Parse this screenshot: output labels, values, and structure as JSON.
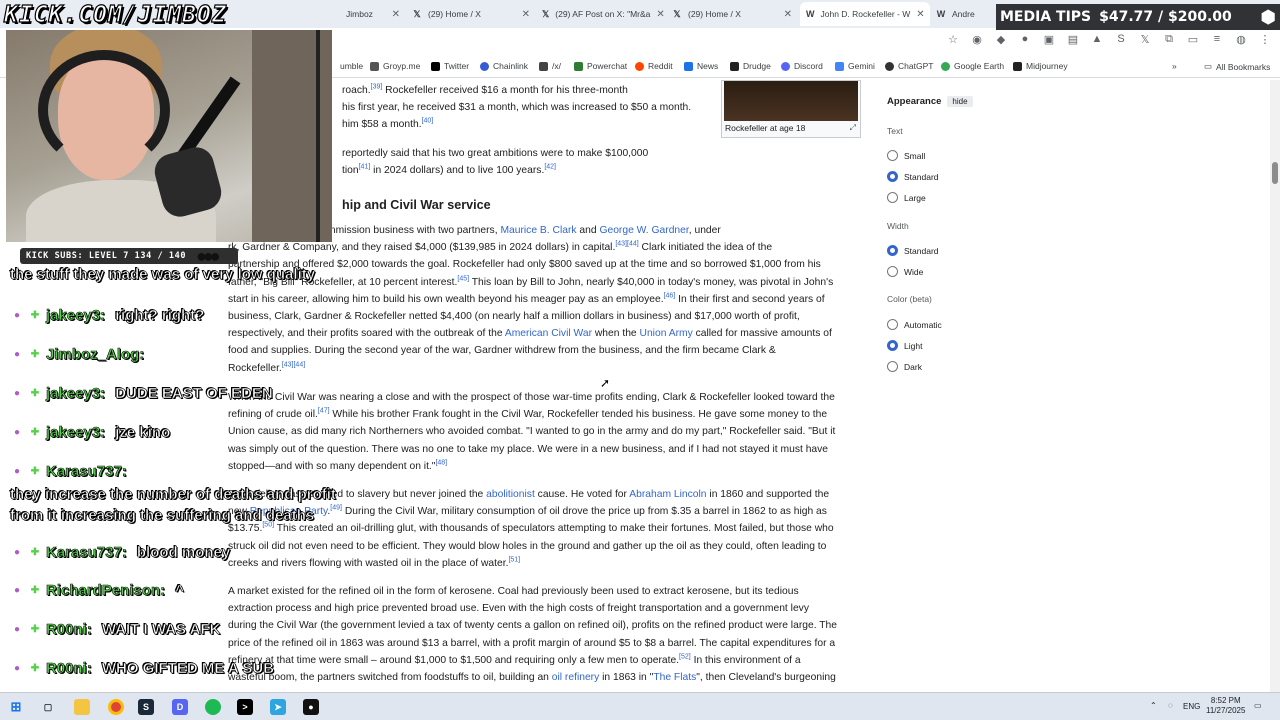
{
  "browser": {
    "tabs": [
      {
        "label": "Jimboz",
        "icon": "doc-icon",
        "active": false
      },
      {
        "label": "(29) Home / X",
        "icon": "x-icon",
        "active": false
      },
      {
        "label": "(29) AF Post on X: \"Mr&a",
        "icon": "x-icon",
        "active": false
      },
      {
        "label": "(29) Home / X",
        "icon": "x-icon",
        "active": false
      },
      {
        "label": "John D. Rockefeller - W",
        "icon": "wikipedia-icon",
        "active": true
      },
      {
        "label": "Andre",
        "icon": "wikipedia-icon",
        "active": false
      }
    ],
    "bookmarks": [
      "umble",
      "Groyp.me",
      "Twitter",
      "Chainlink",
      "/x/",
      "Powerchat",
      "Reddit",
      "News",
      "Drudge",
      "Discord",
      "Gemini",
      "ChatGPT",
      "Google Earth",
      "Midjourney"
    ],
    "all_bookmarks": "All Bookmarks"
  },
  "overlay": {
    "brand": "KICK.COM/JIMBOZ",
    "media_tips": {
      "label": "MEDIA TIPS",
      "progress": "$47.77 / $200.00"
    },
    "kick_subs": "KICK SUBS: LEVEL 7 134 / 140",
    "chat": [
      {
        "type": "line",
        "text": "the stuff they made was of very low quality"
      },
      {
        "type": "msg",
        "user": "jakeey3:",
        "text": "right? right?"
      },
      {
        "type": "msg",
        "user": "Jimboz_Alog:",
        "text": ""
      },
      {
        "type": "msg",
        "user": "jakeey3:",
        "text": "DUDE EAST OF EDEN"
      },
      {
        "type": "msg",
        "user": "jakeey3:",
        "text": "jze kino"
      },
      {
        "type": "msg",
        "user": "Karasu737:",
        "text": ""
      },
      {
        "type": "line",
        "text": "they increase the number of deaths and profit"
      },
      {
        "type": "line",
        "text": "from it increasing the suffering and deaths"
      },
      {
        "type": "msg",
        "user": "Karasu737:",
        "text": "blood money"
      },
      {
        "type": "msg",
        "user": "RichardPenison:",
        "text": "^"
      },
      {
        "type": "msg",
        "user": "R00ni:",
        "text": "WAIT I WAS AFK"
      },
      {
        "type": "msg",
        "user": "R00ni:",
        "text": "WHO GIFTED ME A SUB"
      }
    ]
  },
  "article": {
    "p0_l1": "roach.",
    "p0_l1_ref": "[39]",
    "p0_l1_b": " Rockefeller received $16 a month for his three-month",
    "p0_l2": "his first year, he received $31 a month, which was increased to $50 a month.",
    "p0_l3": "him $58 a month.",
    "p0_l3_ref": "[40]",
    "p1_l1": "reportedly said that his two great ambitions were to make $100,000",
    "p1_l2a": "tion",
    "p1_l2_ref1": "[41]",
    "p1_l2b": " in 2024 dollars) and to live 100 years.",
    "p1_l2_ref2": "[42]",
    "heading": "hip and Civil War service",
    "p2": [
      "nt into the produce commission business with two partners, |Maurice B. Clark| and |George W. Gardner|, under",
      "rk, Gardner & Company, and they raised $4,000 ($139,985 in 2024 dollars) in capital.^[43][44]^ Clark initiated the idea of the",
      "partnership and offered $2,000 towards the goal. Rockefeller had only $800 saved up at the time and so borrowed $1,000 from his",
      "father, \"Big Bill\" Rockefeller, at 10 percent interest.^[45]^ This loan by Bill to John, nearly $40,000 in today's money, was pivotal in John's",
      "start in his career, allowing him to build his own wealth beyond his meager pay as an employee.^[46]^ In their first and second years of",
      "business, Clark, Gardner & Rockefeller netted $4,400 (on nearly half a million dollars in business) and $17,000 worth of profit,",
      "respectively, and their profits soared with the outbreak of the |American Civil War| when the |Union Army| called for massive amounts of",
      "food and supplies. During the second year of the war, Gardner withdrew from the business, and the firm became Clark &",
      "Rockefeller.^[43][44]^"
    ],
    "p3": [
      "When the Civil War was nearing a close and with the prospect of those war-time profits ending, Clark & Rockefeller looked toward the",
      "refining of crude oil.^[47]^ While his brother Frank fought in the Civil War, Rockefeller tended his business. He gave some money to the",
      "Union cause, as did many rich Northerners who avoided combat. \"I wanted to go in the army and do my part,\" Rockefeller said. \"But it",
      "was simply out of the question. There was no one to take my place. We were in a new business, and if I had not stayed it must have",
      "stopped—and with so many dependent on it.\"^[48]^"
    ],
    "p4": [
      "Rockefeller was opposed to slavery but never joined the |abolitionist| cause. He voted for |Abraham Lincoln| in 1860 and supported the",
      "new |Republican Party|.^[49]^ During the Civil War, military consumption of oil drove the price up from $.35 a barrel in 1862 to as high as",
      "$13.75.^[50]^ This created an oil-drilling glut, with thousands of speculators attempting to make their fortunes. Most failed, but those who",
      "struck oil did not even need to be efficient. They would blow holes in the ground and gather up the oil as they could, often leading to",
      "creeks and rivers flowing with wasted oil in the place of water.^[51]^"
    ],
    "p5": [
      "A market existed for the refined oil in the form of kerosene. Coal had previously been used to extract kerosene, but its tedious",
      "extraction process and high price prevented broad use. Even with the high costs of freight transportation and a government levy",
      "during the Civil War (the government levied a tax of twenty cents a gallon on refined oil), profits on the refined product were large. The",
      "price of the refined oil in 1863 was around $13 a barrel, with a profit margin of around $5 to $8 a barrel. The capital expenditures for a",
      "refinery at that time were small – around $1,000 to $1,500 and requiring only a few men to operate.^[52]^ In this environment of a",
      "wasteful boom, the partners switched from foodstuffs to oil, building an |oil refinery| in 1863 in \"|The Flats|\", then Cleveland's burgeoning"
    ],
    "infobox_caption": "Rockefeller at age 18"
  },
  "appearance": {
    "title": "Appearance",
    "hide": "hide",
    "text_label": "Text",
    "text_options": [
      {
        "label": "Small",
        "checked": false
      },
      {
        "label": "Standard",
        "checked": true
      },
      {
        "label": "Large",
        "checked": false
      }
    ],
    "width_label": "Width",
    "width_options": [
      {
        "label": "Standard",
        "checked": true
      },
      {
        "label": "Wide",
        "checked": false
      }
    ],
    "color_label": "Color (beta)",
    "color_options": [
      {
        "label": "Automatic",
        "checked": false
      },
      {
        "label": "Light",
        "checked": true
      },
      {
        "label": "Dark",
        "checked": false
      }
    ]
  },
  "taskbar": {
    "lang": "ENG",
    "time": "8:52 PM",
    "date": "11/27/2025"
  },
  "colors": {
    "link": "#3366cc",
    "chat_user": "#55d14a",
    "radio_on": "#3366cc"
  }
}
